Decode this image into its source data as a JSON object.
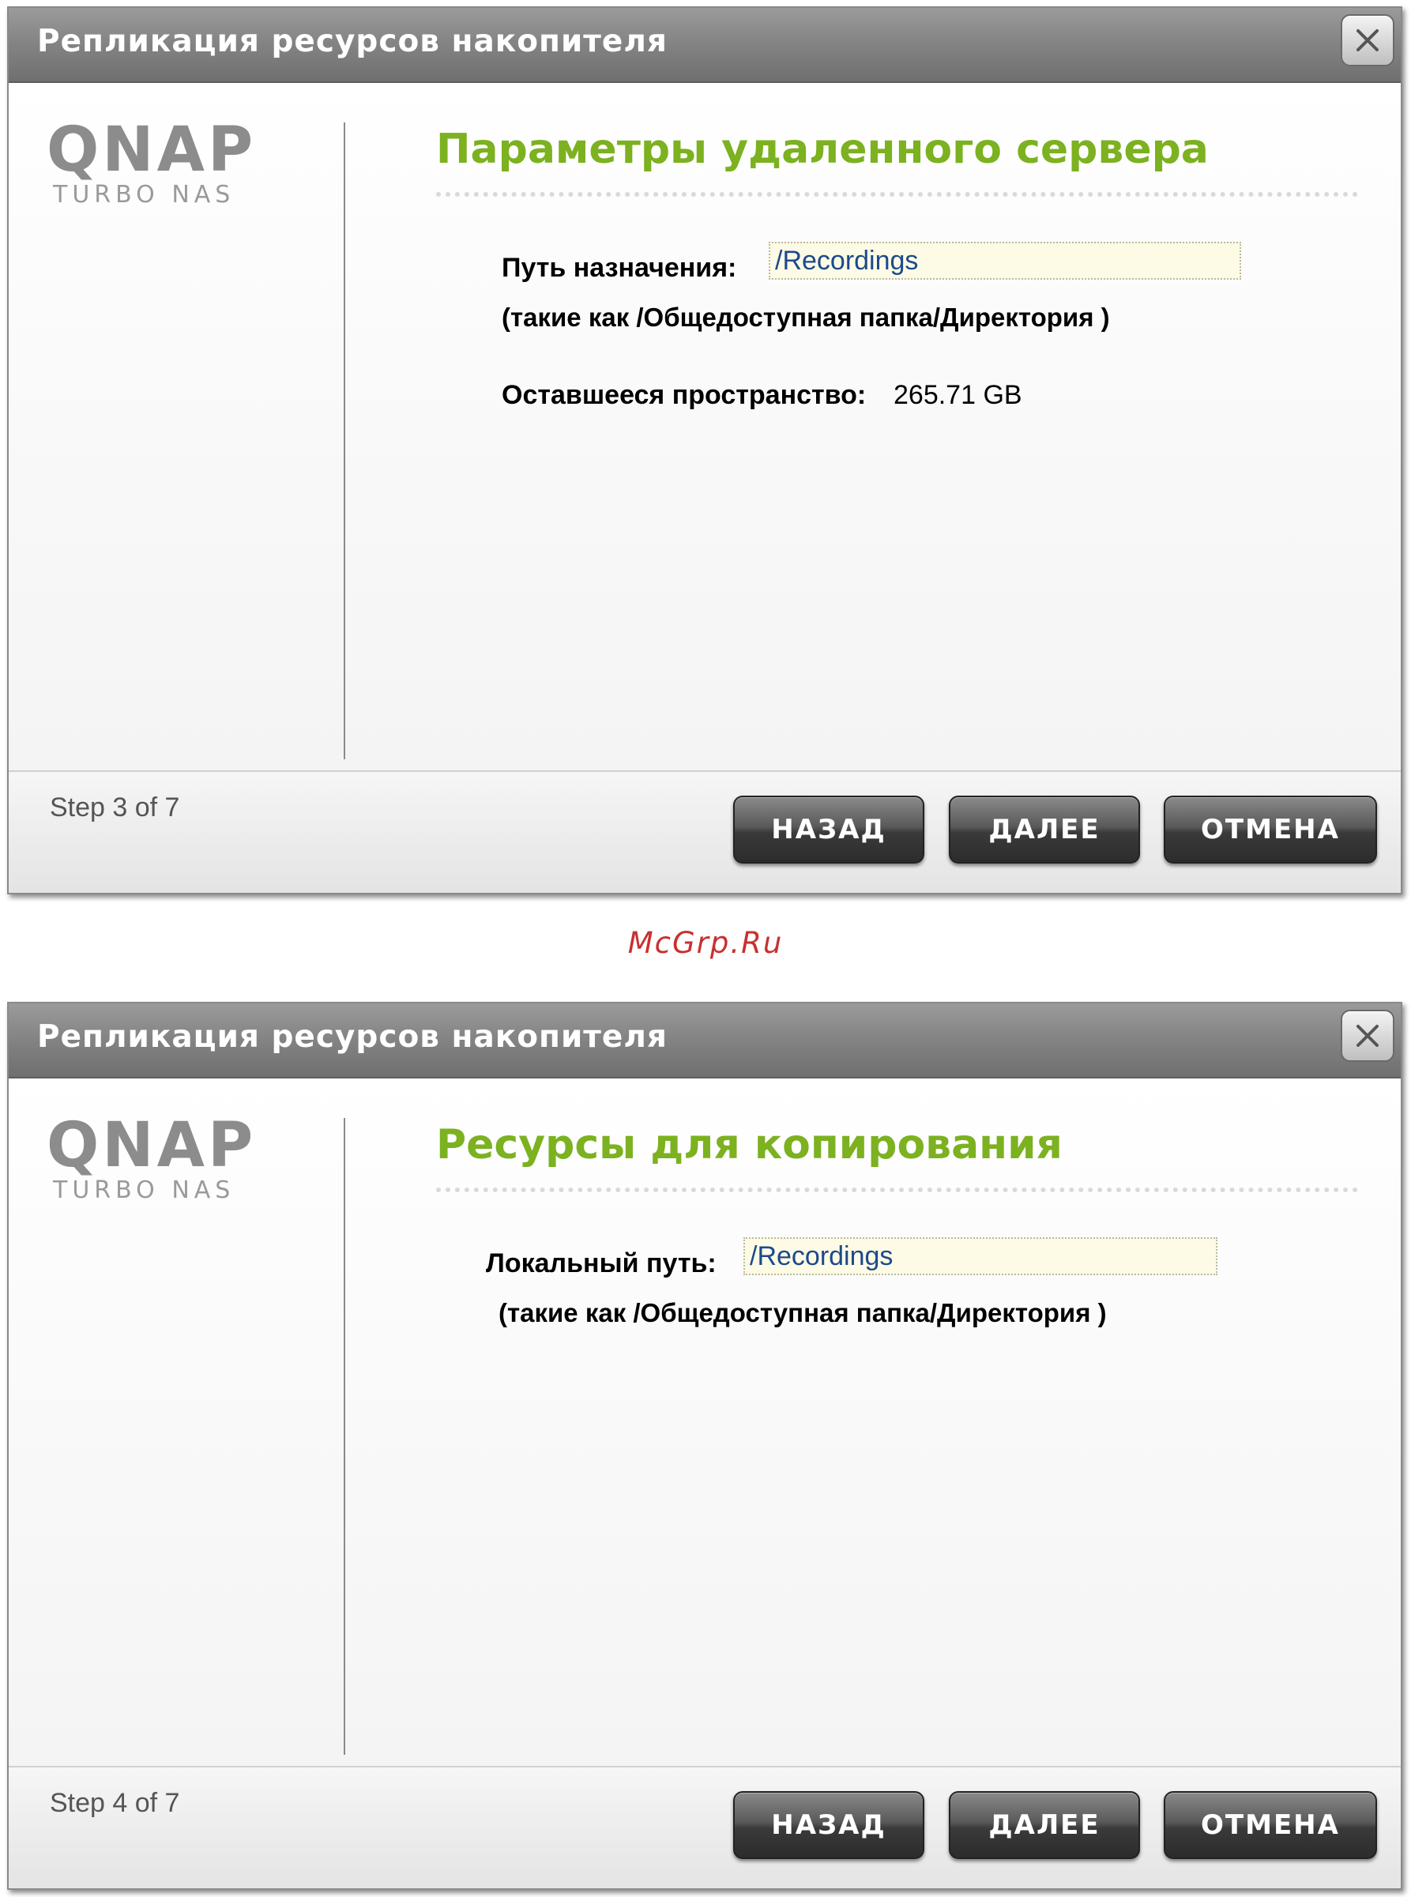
{
  "watermark": "McGrp.Ru",
  "dialogs": [
    {
      "title": "Репликация ресурсов накопителя",
      "logo": {
        "word": "QNAP",
        "sub": "TURBO NAS"
      },
      "section_title": "Параметры удаленного сервера",
      "path_label": "Путь назначения:",
      "path_value": "/Recordings",
      "hint": "(такие как /Общедоступная папка/Директория )",
      "space_label": "Оставшееся пространство:",
      "space_value": "265.71 GB",
      "step": "Step 3 of 7",
      "buttons": {
        "back": "НАЗАД",
        "next": "ДАЛЕЕ",
        "cancel": "ОТМЕНА"
      }
    },
    {
      "title": "Репликация ресурсов накопителя",
      "logo": {
        "word": "QNAP",
        "sub": "TURBO NAS"
      },
      "section_title": "Ресурсы для копирования",
      "path_label": "Локальный путь:",
      "path_value": "/Recordings",
      "hint": "(такие как /Общедоступная папка/Директория )",
      "step": "Step 4 of 7",
      "buttons": {
        "back": "НАЗАД",
        "next": "ДАЛЕЕ",
        "cancel": "ОТМЕНА"
      }
    }
  ],
  "colors": {
    "title_green": "#7cb120",
    "input_text_blue": "#1d4a8a",
    "watermark_red": "#c83030"
  },
  "icons": {
    "close": "close-x-icon"
  }
}
